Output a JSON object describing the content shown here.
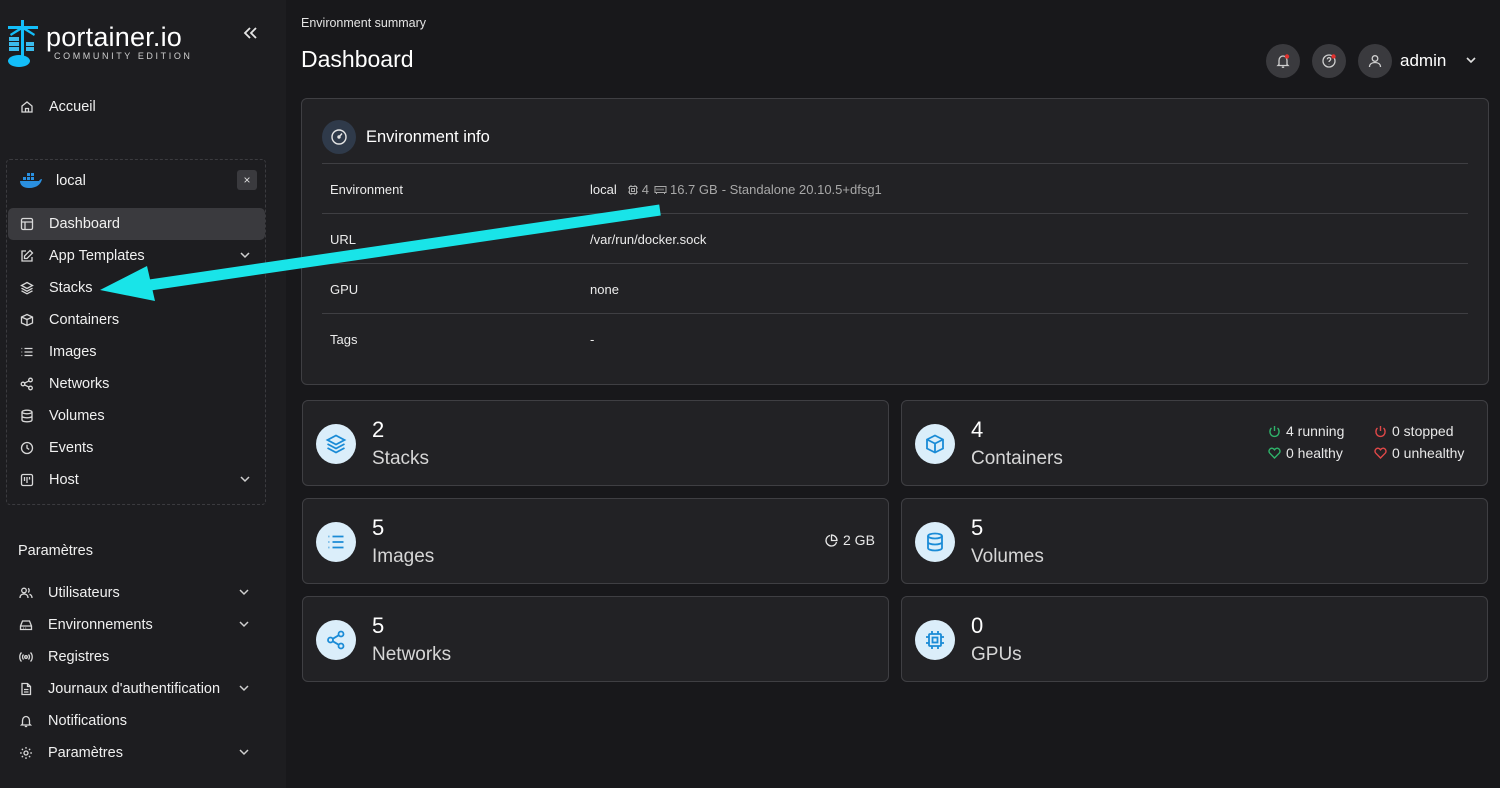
{
  "brand": {
    "title": "portainer.io",
    "subtitle": "COMMUNITY EDITION"
  },
  "sidebar": {
    "home": "Accueil",
    "environment": {
      "name": "local",
      "close": "×"
    },
    "env_items": [
      {
        "label": "Dashboard",
        "icon": "dashboard-icon",
        "active": true
      },
      {
        "label": "App Templates",
        "icon": "edit-icon",
        "has_chevron": true
      },
      {
        "label": "Stacks",
        "icon": "layers-icon"
      },
      {
        "label": "Containers",
        "icon": "box-icon"
      },
      {
        "label": "Images",
        "icon": "list-icon"
      },
      {
        "label": "Networks",
        "icon": "share-icon"
      },
      {
        "label": "Volumes",
        "icon": "database-icon"
      },
      {
        "label": "Events",
        "icon": "clock-icon"
      },
      {
        "label": "Host",
        "icon": "host-icon",
        "has_chevron": true
      }
    ],
    "settings_title": "Paramètres",
    "settings_items": [
      {
        "label": "Utilisateurs",
        "icon": "users-icon",
        "has_chevron": true
      },
      {
        "label": "Environnements",
        "icon": "hdd-icon",
        "has_chevron": true
      },
      {
        "label": "Registres",
        "icon": "radio-icon"
      },
      {
        "label": "Journaux d'authentification",
        "icon": "file-icon",
        "has_chevron": true
      },
      {
        "label": "Notifications",
        "icon": "bell-icon"
      },
      {
        "label": "Paramètres",
        "icon": "gear-icon",
        "has_chevron": true
      }
    ]
  },
  "header": {
    "breadcrumb": "Environment summary",
    "title": "Dashboard",
    "user": "admin"
  },
  "env_info": {
    "title": "Environment info",
    "rows": [
      {
        "key": "Environment",
        "value": "local",
        "cpu": "4",
        "memory": "16.7 GB",
        "detail": "- Standalone 20.10.5+dfsg1"
      },
      {
        "key": "URL",
        "value": "/var/run/docker.sock"
      },
      {
        "key": "GPU",
        "value": "none"
      },
      {
        "key": "Tags",
        "value": "-"
      }
    ]
  },
  "stats": {
    "stacks": {
      "count": "2",
      "label": "Stacks"
    },
    "containers": {
      "count": "4",
      "label": "Containers",
      "running": "4 running",
      "stopped": "0 stopped",
      "healthy": "0 healthy",
      "unhealthy": "0 unhealthy"
    },
    "images": {
      "count": "5",
      "label": "Images",
      "size": "2 GB"
    },
    "volumes": {
      "count": "5",
      "label": "Volumes"
    },
    "networks": {
      "count": "5",
      "label": "Networks"
    },
    "gpus": {
      "count": "0",
      "label": "GPUs"
    }
  },
  "colors": {
    "accent": "#1a8bd6",
    "annotation_arrow": "#19e4e8",
    "running": "#2fb36a",
    "stopped": "#e04848"
  }
}
